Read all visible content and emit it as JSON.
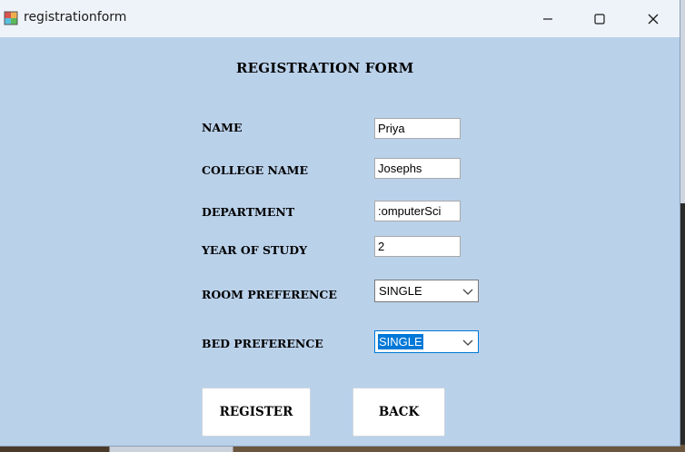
{
  "window": {
    "title": "registrationform"
  },
  "form": {
    "heading": "REGISTRATION FORM",
    "fields": {
      "name": {
        "label": "NAME",
        "value": "Priya"
      },
      "college": {
        "label": "COLLEGE NAME",
        "value": "Josephs"
      },
      "department": {
        "label": "DEPARTMENT",
        "value": ":omputerSci"
      },
      "year": {
        "label": "YEAR OF STUDY",
        "value": "2"
      },
      "room": {
        "label": "ROOM PREFERENCE",
        "value": "SINGLE"
      },
      "bed": {
        "label": "BED PREFERENCE",
        "value": "SINGLE"
      }
    },
    "buttons": {
      "register": "REGISTER",
      "back": "BACK"
    }
  },
  "colors": {
    "form_background": "#bad1ea",
    "titlebar": "#eef3f9",
    "selection": "#0078d7"
  },
  "icons": {
    "app": "app-form-icon",
    "minimize": "minimize-icon",
    "maximize": "maximize-icon",
    "close": "close-icon",
    "dropdown": "chevron-down-icon"
  }
}
